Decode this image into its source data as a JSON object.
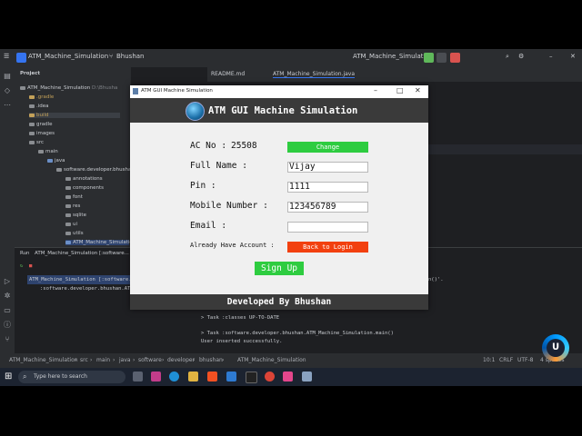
{
  "ide": {
    "project_name": "ATM_Machine_Simulation",
    "branch": "Bhushan",
    "run_config": "ATM_Machine_Simulation",
    "project_panel_title": "Project",
    "tree": [
      {
        "label": "ATM_Machine_Simulation",
        "suffix": "D:\\Bhusha"
      },
      {
        "label": ".gradle"
      },
      {
        "label": ".idea"
      },
      {
        "label": "build"
      },
      {
        "label": "gradle"
      },
      {
        "label": "images"
      },
      {
        "label": "src"
      },
      {
        "label": "main"
      },
      {
        "label": "java"
      },
      {
        "label": "software.developer.bhushan"
      },
      {
        "label": "annotations"
      },
      {
        "label": "components"
      },
      {
        "label": "font"
      },
      {
        "label": "res"
      },
      {
        "label": "sqlite"
      },
      {
        "label": "ui"
      },
      {
        "label": "utils"
      },
      {
        "label": "ATM_Machine_Simulation"
      }
    ],
    "tabs": [
      "README.md",
      "ATM_Machine_Simulation.java"
    ],
    "run_tab": "Run",
    "run_config_tab": "ATM_Machine_Simulation [:software...",
    "run_tree": [
      "ATM_Machine_Simulation [:software.developer...",
      ":software.developer.bhushan.ATM_Ma..."
    ],
    "console": [
      "> Task :classes UP-TO-DATE",
      "> Task :software.developer.bhushan.ATM_Machine_Simulation.main()",
      "User inserted successfully."
    ],
    "console_fragment": "n()'.",
    "breadcrumb": [
      "ATM_Machine_Simulation",
      "src",
      "main",
      "java",
      "software",
      "developer",
      "bhushan",
      "ATM_Machine_Simulation"
    ],
    "status_right": [
      "10:1",
      "CRLF",
      "UTF-8",
      "4 spaces"
    ]
  },
  "atm_window": {
    "title": "ATM GUI Machine Simulation",
    "header": "ATM GUI Machine Simulation",
    "ac_no_label": "AC No :",
    "ac_no_value": "25508",
    "change_button": "Change",
    "full_name_label": "Full Name :",
    "full_name_value": "Vijay",
    "pin_label": "Pin :",
    "pin_value": "1111",
    "mobile_label": "Mobile Number :",
    "mobile_value": "123456789",
    "email_label": "Email :",
    "email_value": "",
    "already_label": "Already Have Account :",
    "back_to_login": "Back to Login",
    "sign_up": "Sign Up",
    "footer": "Developed By Bhushan"
  },
  "taskbar": {
    "search_placeholder": "Type here to search"
  },
  "colors": {
    "green_button": "#2ecc40",
    "red_button": "#f2400f",
    "header_dark": "#3a3a3a"
  }
}
